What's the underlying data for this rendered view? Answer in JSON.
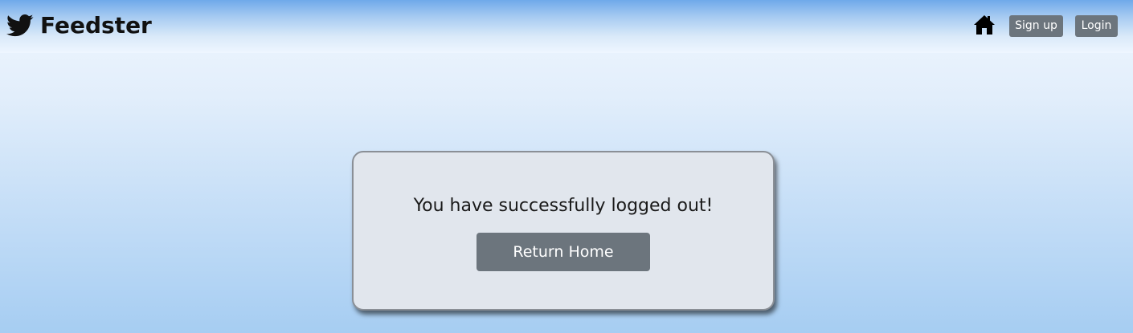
{
  "navbar": {
    "brand_name": "Feedster",
    "brand_icon": "twitter-bird-icon",
    "home_icon": "home-icon",
    "signup_label": "Sign up",
    "login_label": "Login"
  },
  "logout_card": {
    "message": "You have successfully logged out!",
    "return_home_label": "Return Home"
  },
  "colors": {
    "button_gray": "#6c757d",
    "card_background": "#e1e6ed"
  }
}
